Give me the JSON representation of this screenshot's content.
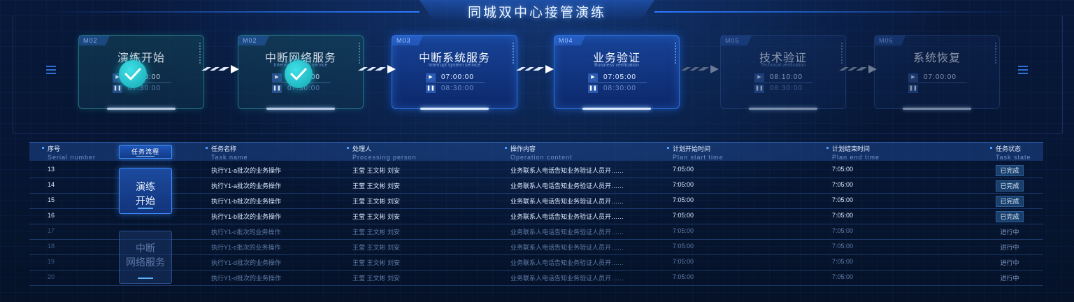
{
  "title": "同城双中心接管演练",
  "colors": {
    "accent": "#2b78ff",
    "done": "#15a8b5",
    "background": "#06142f"
  },
  "steps": [
    {
      "code": "M02",
      "name": "演练开始",
      "sub": "",
      "time1": "07:00:00",
      "time2": "07:30:00",
      "state": "done"
    },
    {
      "code": "M02",
      "name": "中断网络服务",
      "sub": "Interrupt network service",
      "time1": "07:00:00",
      "time2": "07:30:00",
      "state": "done"
    },
    {
      "code": "M03",
      "name": "中断系统服务",
      "sub": "Interrupt system service",
      "time1": "07:00:00",
      "time2": "08:30:00",
      "state": "active"
    },
    {
      "code": "M04",
      "name": "业务验证",
      "sub": "Business verification",
      "time1": "07:05:00",
      "time2": "08:30:00",
      "state": "active"
    },
    {
      "code": "M05",
      "name": "技术验证",
      "sub": "Technical verification",
      "time1": "08:10:00",
      "time2": "08:30:00",
      "state": "pending"
    },
    {
      "code": "M06",
      "name": "系统恢复",
      "sub": "",
      "time1": "07:00:00",
      "time2": "",
      "state": "pending"
    }
  ],
  "icons": {
    "play": "play-icon",
    "pause": "pause-icon",
    "check": "check-icon",
    "arrow": "arrow-right-icon"
  },
  "table": {
    "flow_button": "任务流程",
    "headers": [
      {
        "zh": "序号",
        "en": "Serial number"
      },
      {
        "zh": "任务名称",
        "en": "Task name"
      },
      {
        "zh": "处理人",
        "en": "Processing person"
      },
      {
        "zh": "操作内容",
        "en": "Operation content"
      },
      {
        "zh": "计划开始时间",
        "en": "Plan start time"
      },
      {
        "zh": "计划结束时间",
        "en": "Plan end time"
      },
      {
        "zh": "任务状态",
        "en": "Task state"
      }
    ],
    "groups": [
      {
        "line1": "演练",
        "line2": "开始"
      },
      {
        "line1": "中断",
        "line2": "网络服务"
      }
    ],
    "rows": [
      {
        "serial": "13",
        "task": "执行Y1-a批次的业务操作",
        "persons": "王莹   王文彬   刘安",
        "content": "业务联系人电话告知业务验证人员开……",
        "start": "7:05:00",
        "end": "7:05:00",
        "state": "已完成"
      },
      {
        "serial": "14",
        "task": "执行Y1-a批次的业务操作",
        "persons": "王莹   王文彬   刘安",
        "content": "业务联系人电话告知业务验证人员开……",
        "start": "7:05:00",
        "end": "7:05:00",
        "state": "已完成"
      },
      {
        "serial": "15",
        "task": "执行Y1-b批次的业务操作",
        "persons": "王莹   王文彬   刘安",
        "content": "业务联系人电话告知业务验证人员开……",
        "start": "7:05:00",
        "end": "7:05:00",
        "state": "已完成"
      },
      {
        "serial": "16",
        "task": "执行Y1-b批次的业务操作",
        "persons": "王莹   王文彬   刘安",
        "content": "业务联系人电话告知业务验证人员开……",
        "start": "7:05:00",
        "end": "7:05:00",
        "state": "已完成"
      },
      {
        "serial": "17",
        "task": "执行Y1-c批次的业务操作",
        "persons": "王莹   王文彬   刘安",
        "content": "业务联系人电话告知业务验证人员开……",
        "start": "7:05:00",
        "end": "7:05:00",
        "state": "进行中"
      },
      {
        "serial": "18",
        "task": "执行Y1-c批次的业务操作",
        "persons": "王莹   王文彬   刘安",
        "content": "业务联系人电话告知业务验证人员开……",
        "start": "7:05:00",
        "end": "7:05:00",
        "state": "进行中"
      },
      {
        "serial": "19",
        "task": "执行Y1-d批次的业务操作",
        "persons": "王莹   王文彬   刘安",
        "content": "业务联系人电话告知业务验证人员开……",
        "start": "7:05:00",
        "end": "7:05:00",
        "state": "进行中"
      },
      {
        "serial": "20",
        "task": "执行Y1-d批次的业务操作",
        "persons": "王莹   王文彬   刘安",
        "content": "业务联系人电话告知业务验证人员开……",
        "start": "7:05:00",
        "end": "7:05:00",
        "state": "进行中"
      }
    ]
  }
}
